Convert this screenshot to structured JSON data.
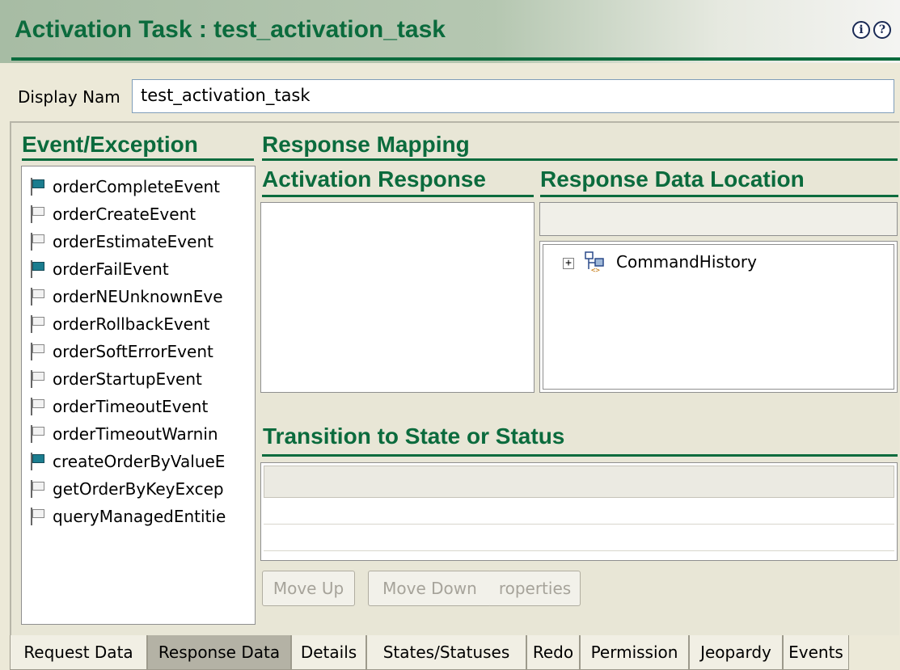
{
  "window": {
    "title": "Activation Task : test_activation_task",
    "info_icon": "info-icon",
    "help_icon": "help-icon"
  },
  "display_name": {
    "label": "Display Nam",
    "value": "test_activation_task"
  },
  "event_exception": {
    "heading": "Event/Exception",
    "items": [
      {
        "label": "orderCompleteEvent",
        "active": true
      },
      {
        "label": "orderCreateEvent",
        "active": false
      },
      {
        "label": "orderEstimateEvent",
        "active": false
      },
      {
        "label": "orderFailEvent",
        "active": true
      },
      {
        "label": "orderNEUnknownEve",
        "active": false
      },
      {
        "label": "orderRollbackEvent",
        "active": false
      },
      {
        "label": "orderSoftErrorEvent",
        "active": false
      },
      {
        "label": "orderStartupEvent",
        "active": false
      },
      {
        "label": "orderTimeoutEvent",
        "active": false
      },
      {
        "label": "orderTimeoutWarnin",
        "active": false
      },
      {
        "label": "createOrderByValueE",
        "active": true
      },
      {
        "label": "getOrderByKeyExcep",
        "active": false
      },
      {
        "label": "queryManagedEntitie",
        "active": false
      }
    ]
  },
  "response_mapping": {
    "heading": "Response Mapping",
    "activation_response": {
      "heading": "Activation Response"
    },
    "response_data_location": {
      "heading": "Response Data Location",
      "tree_root": "CommandHistory"
    }
  },
  "transition": {
    "heading": "Transition to State or Status",
    "buttons": {
      "move_up": "Move Up",
      "move_down": "Move Down",
      "properties": "roperties"
    }
  },
  "tabs": [
    {
      "label": "Request Data",
      "selected": false
    },
    {
      "label": "Response Data",
      "selected": true
    },
    {
      "label": "Details",
      "selected": false
    },
    {
      "label": "States/Statuses",
      "selected": false
    },
    {
      "label": "Redo",
      "selected": false
    },
    {
      "label": "Permission",
      "selected": false
    },
    {
      "label": "Jeopardy",
      "selected": false
    },
    {
      "label": "Events",
      "selected": false
    }
  ],
  "colors": {
    "accent_green": "#0b6b3d",
    "active_flag": "#1b7d8f",
    "window_bg": "#ece9d8"
  }
}
